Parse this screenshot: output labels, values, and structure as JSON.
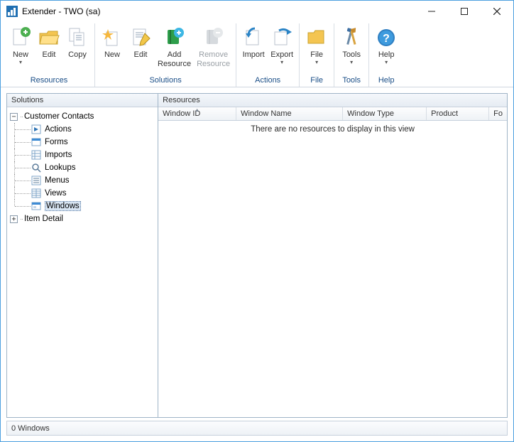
{
  "window": {
    "title": "Extender  -  TWO (sa)"
  },
  "ribbon": {
    "groups": {
      "resources": {
        "label": "Resources",
        "new": "New",
        "edit": "Edit",
        "copy": "Copy"
      },
      "solutions": {
        "label": "Solutions",
        "new": "New",
        "edit": "Edit",
        "add": "Add\nResource",
        "remove": "Remove\nResource"
      },
      "actions": {
        "label": "Actions",
        "import": "Import",
        "export": "Export"
      },
      "file": {
        "label": "File",
        "file": "File"
      },
      "tools": {
        "label": "Tools",
        "tools": "Tools"
      },
      "help": {
        "label": "Help",
        "help": "Help"
      }
    }
  },
  "left": {
    "header": "Solutions",
    "tree": {
      "root1": "Customer Contacts",
      "children": {
        "actions": "Actions",
        "forms": "Forms",
        "imports": "Imports",
        "lookups": "Lookups",
        "menus": "Menus",
        "views": "Views",
        "windows": "Windows"
      },
      "root2": "Item Detail"
    }
  },
  "right": {
    "header": "Resources",
    "columns": {
      "window_id": "Window ID",
      "window_name": "Window Name",
      "window_type": "Window Type",
      "product": "Product",
      "form": "Fo"
    },
    "empty": "There are no resources to display in this view"
  },
  "status": "0 Windows"
}
